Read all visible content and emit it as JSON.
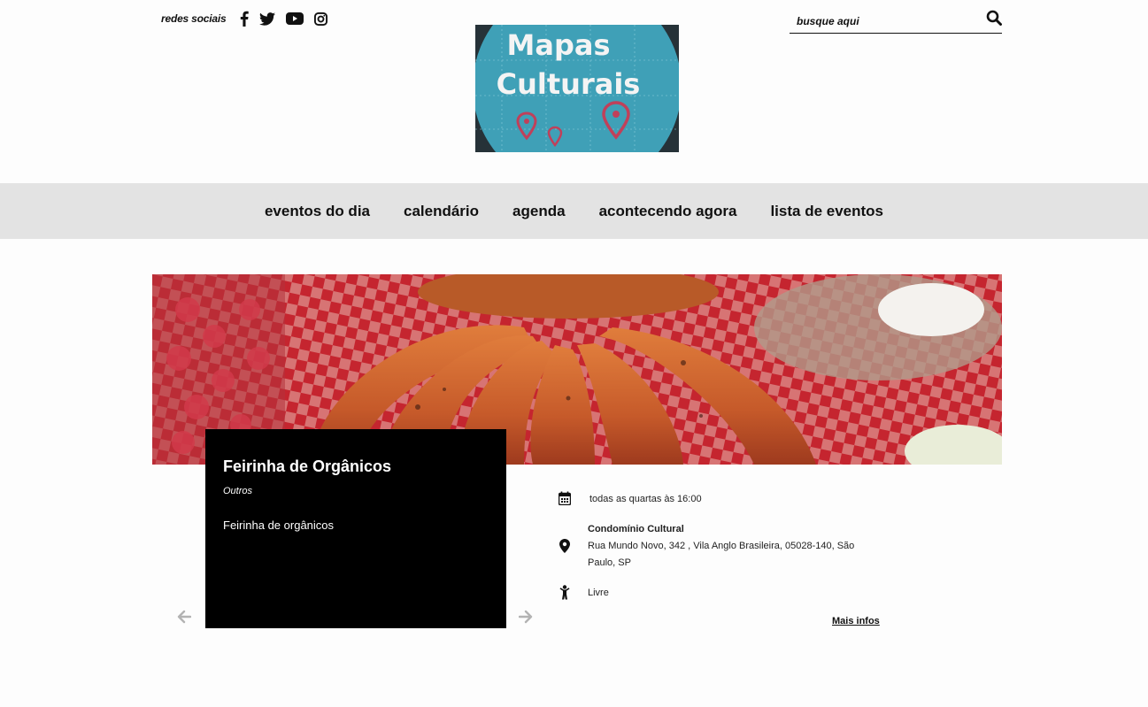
{
  "header": {
    "social_label": "redes sociais",
    "social_icons": [
      "facebook-icon",
      "twitter-icon",
      "youtube-icon",
      "instagram-icon"
    ],
    "search_placeholder": "busque aqui"
  },
  "logo": {
    "line1": "Mapas",
    "line2": "Culturais"
  },
  "nav": {
    "items": [
      "eventos do dia",
      "calendário",
      "agenda",
      "acontecendo agora",
      "lista de eventos"
    ]
  },
  "event": {
    "title": "Feirinha de Orgânicos",
    "category": "Outros",
    "description": "Feirinha de orgânicos",
    "schedule": "todas as quartas às 16:00",
    "venue": "Condomínio Cultural",
    "address_line1": "Rua Mundo Novo, 342 , Vila Anglo Brasileira, 05028-140, São",
    "address_line2": "Paulo, SP",
    "rating": "Livre",
    "more_label": "Mais infos"
  },
  "colors": {
    "nav_bg": "#e3e3e3",
    "logo_bg": "#3fa0b7",
    "pin": "#c0405a",
    "card_bg": "#000000"
  }
}
